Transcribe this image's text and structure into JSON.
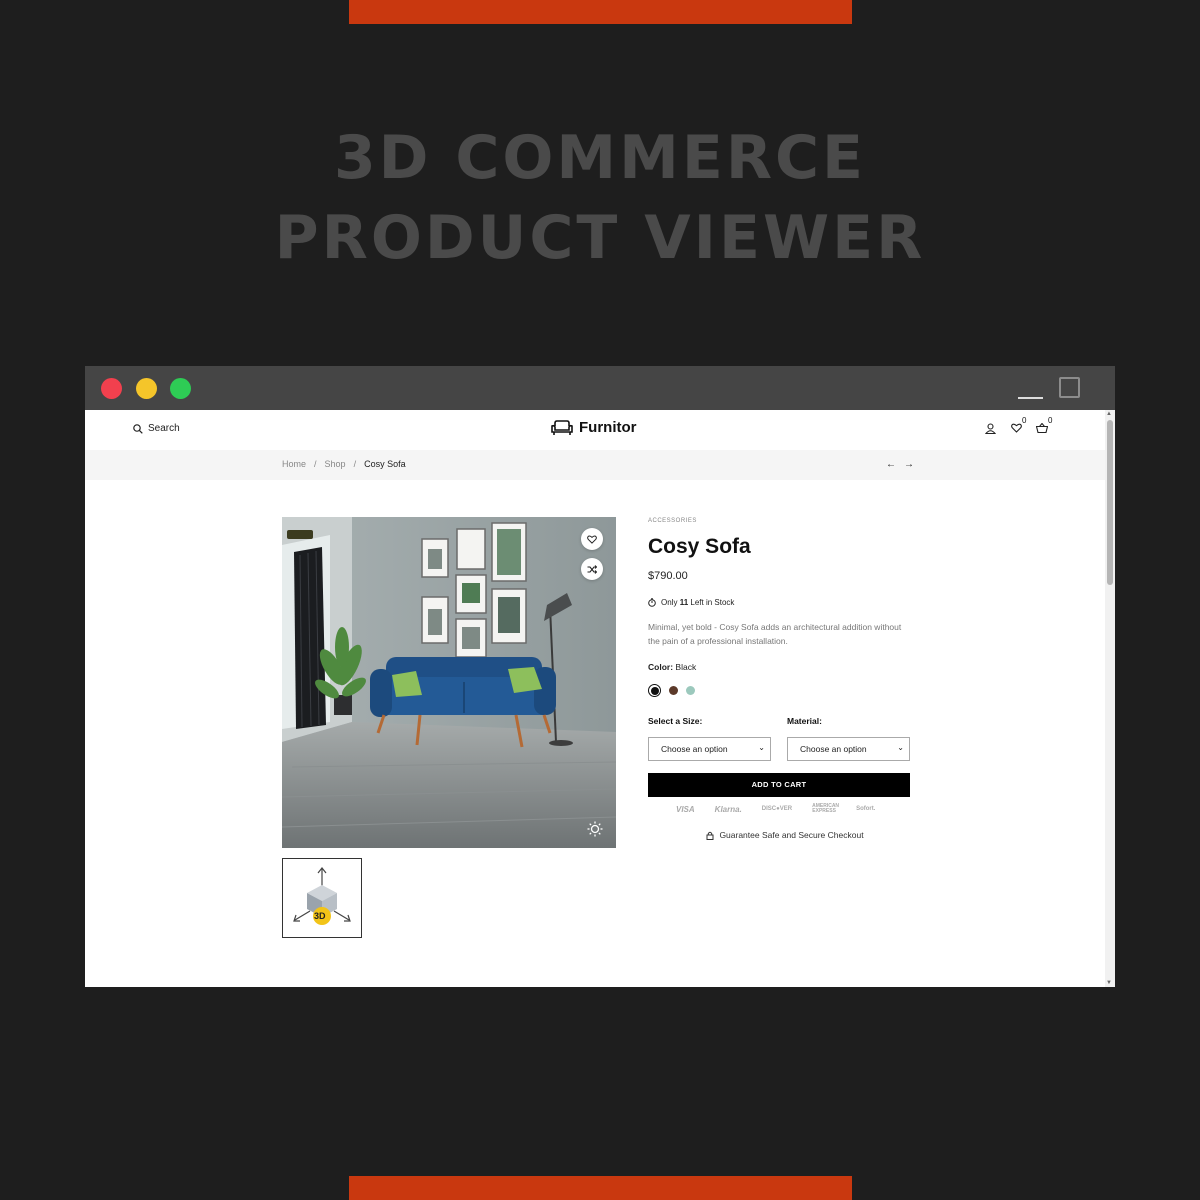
{
  "banner": {
    "line1": "3D COMMERCE",
    "line2": "PRODUCT VIEWER"
  },
  "colors": {
    "accent": "#c9380f",
    "background": "#1e1e1e",
    "titlebar": "#454545",
    "button": "#000000"
  },
  "header": {
    "search_label": "Search",
    "logo_text": "Furnitor",
    "wishlist_count": "0",
    "cart_count": "0"
  },
  "breadcrumb": {
    "items": [
      "Home",
      "Shop",
      "Cosy Sofa"
    ],
    "separator": "/"
  },
  "product": {
    "category": "ACCESSORIES",
    "title": "Cosy Sofa",
    "price": "$790.00",
    "stock_prefix": "Only",
    "stock_count": "11",
    "stock_suffix": "Left in Stock",
    "description": "Minimal, yet bold - Cosy Sofa adds an architectural addition without the pain of a professional installation.",
    "color_label": "Color:",
    "color_value": "Black",
    "swatches": [
      {
        "name": "black",
        "hex": "#111111",
        "selected": true
      },
      {
        "name": "brown",
        "hex": "#5c3a2a",
        "selected": false
      },
      {
        "name": "mint",
        "hex": "#9cc9bd",
        "selected": false
      }
    ],
    "size_label": "Select a Size:",
    "size_placeholder": "Choose an option",
    "material_label": "Material:",
    "material_placeholder": "Choose an option",
    "add_to_cart": "ADD TO CART",
    "payment_methods": [
      "VISA",
      "Klarna.",
      "DISC●VER",
      "AMERICAN EXPRESS",
      "Sofort."
    ],
    "secure_text": "Guarantee Safe and Secure Checkout"
  },
  "thumbnail": {
    "badge_text": "3D"
  }
}
